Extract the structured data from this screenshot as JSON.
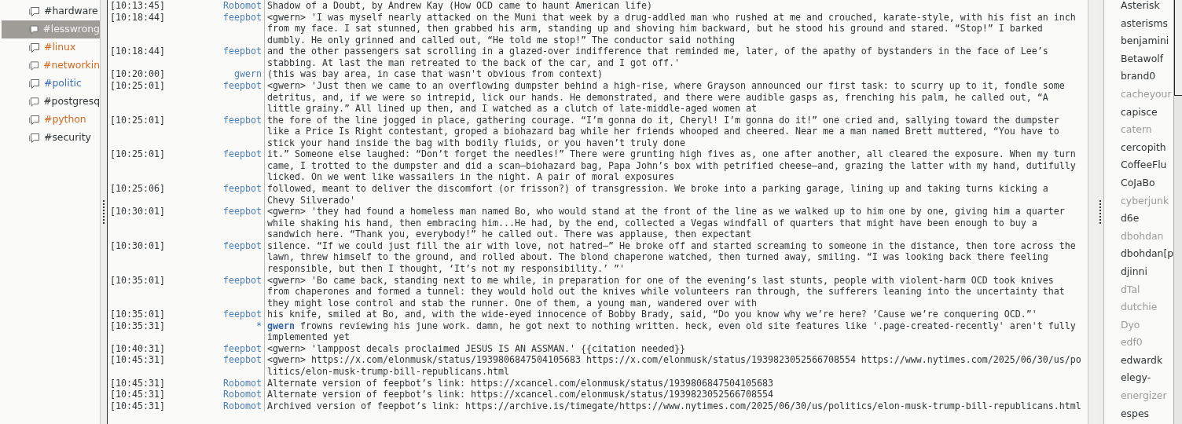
{
  "channels": [
    {
      "name": "#hardware",
      "selected": false,
      "color": "#2e3436"
    },
    {
      "name": "#lesswrong",
      "selected": true,
      "color": "#f4f4f2"
    },
    {
      "name": "#linux",
      "selected": false,
      "color": "#d2691e"
    },
    {
      "name": "#networkin",
      "selected": false,
      "color": "#d2691e"
    },
    {
      "name": "#politic",
      "selected": false,
      "color": "#3d6fb6"
    },
    {
      "name": "#postgresq",
      "selected": false,
      "color": "#2e3436"
    },
    {
      "name": "#python",
      "selected": false,
      "color": "#d2691e"
    },
    {
      "name": "#security",
      "selected": false,
      "color": "#2e3436"
    }
  ],
  "messages": [
    {
      "time": "[10:13:45]",
      "nick": "Robomot",
      "kind": "message",
      "lines": [
        "Shadow of a Doubt, by Andrew Kay (How OCD came to haunt American life)"
      ]
    },
    {
      "time": "[10:18:44]",
      "nick": "feepbot",
      "kind": "message",
      "lines": [
        "<gwern> 'I was myself nearly attacked on the Muni that week by a drug-addled man who rushed at me and crouched, karate-style, with his fist an inch",
        "from my face. I sat stunned, then grabbed his arm, standing up and shoving him backward, but he stood his ground and stared. “Stop!” I barked",
        "dumbly. He only grinned and called out, “He told me stop!” The conductor said nothing"
      ]
    },
    {
      "time": "[10:18:44]",
      "nick": "feepbot",
      "kind": "message",
      "lines": [
        "and the other passengers sat scrolling in a glazed-over indifference that reminded me, later, of the apathy of bystanders in the face of Lee’s",
        "stabbing. At last the man retreated to the back of the car, and I got off.'"
      ]
    },
    {
      "time": "[10:20:00]",
      "nick": "gwern",
      "kind": "message",
      "lines": [
        "(this was bay area, in case that wasn't obvious from context)"
      ]
    },
    {
      "time": "[10:25:01]",
      "nick": "feepbot",
      "kind": "message",
      "lines": [
        "<gwern> 'Just then we came to an overflowing dumpster behind a high-rise, where Grayson announced our first task: to scurry up to it, fondle some",
        "detritus, and, if we were so intrepid, lick our hands. He demonstrated, and there were audible gasps as, frenching his palm, he called out, “A",
        "little grainy.” All lined up then, and I watched as a clutch of late-middle-aged women at"
      ]
    },
    {
      "time": "[10:25:01]",
      "nick": "feepbot",
      "kind": "message",
      "lines": [
        "the fore of the line jogged in place, gathering courage. “I’m gonna do it, Cheryl! I’m gonna do it!” one cried and, sallying toward the dumpster",
        "like a Price Is Right contestant, groped a biohazard bag while her friends whooped and cheered. Near me a man named Brett muttered, “You have to",
        "stick your hand inside the bag with bodily fluids, or you haven’t truly done"
      ]
    },
    {
      "time": "[10:25:01]",
      "nick": "feepbot",
      "kind": "message",
      "lines": [
        "it.” Someone else laughed: “Don’t forget the needles!” There were grunting high fives as, one after another, all cleared the exposure. When my turn",
        "came, I trotted to the dumpster and did a scan—biohazard bag, Papa John’s box with petrified cheese—and, grazing the latter with my hand, dutifully",
        "licked. On we went like wassailers in the night. A pair of moral exposures"
      ]
    },
    {
      "time": "[10:25:06]",
      "nick": "feepbot",
      "kind": "message",
      "lines": [
        "followed, meant to deliver the discomfort (or frisson?) of transgression. We broke into a parking garage, lining up and taking turns kicking a",
        "Chevy Silverado'"
      ]
    },
    {
      "time": "[10:30:01]",
      "nick": "feepbot",
      "kind": "message",
      "lines": [
        "<gwern> 'they had found a homeless man named Bo, who would stand at the front of the line as we walked up to him one by one, giving him a quarter",
        "while shaking his hand, then embracing him...He had, by the end, collected a Vegas windfall of quarters that might have been enough to buy a",
        "sandwich here. “Thank you, everybody!” he called out. There was applause, then expectant"
      ]
    },
    {
      "time": "[10:30:01]",
      "nick": "feepbot",
      "kind": "message",
      "lines": [
        "silence. “If we could just fill the air with love, not hatred—” He broke off and started screaming to someone in the distance, then tore across the",
        "lawn, threw himself to the ground, and rolled about. The blond chaperone watched, then turned away, smiling. “I was looking back there feeling",
        "responsible, but then I thought, ‘It’s not my responsibility.’ ”'"
      ]
    },
    {
      "time": "[10:35:01]",
      "nick": "feepbot",
      "kind": "message",
      "lines": [
        "<gwern> 'Bo came back, standing next to me while, in preparation for one of the evening’s last stunts, people with violent-harm OCD took knives",
        "from chaperones and formed a tunnel: they would hold out the knives while volunteers ran through, the sufferers leaning into the uncertainty that",
        "they might lose control and stab the runner. One of them, a young man, wandered over with"
      ]
    },
    {
      "time": "[10:35:01]",
      "nick": "feepbot",
      "kind": "message",
      "lines": [
        "his knife, smiled at Bo, and, with the wide-eyed innocence of Bobby Brady, said, “Do you know why we’re here? ’Cause we’re conquering OCD.”'"
      ]
    },
    {
      "time": "[10:35:31]",
      "nick": "*",
      "kind": "action",
      "lines": [
        "**gwern** frowns reviewing his june work. damn, he got next to nothing written. heck, even old site features like '.page-created-recently' aren't fully",
        "implemented yet"
      ]
    },
    {
      "time": "[10:40:31]",
      "nick": "feepbot",
      "kind": "message",
      "lines": [
        "<gwern> 'lamppost decals proclaimed JESUS IS AN ASSMAN.' {{citation needed}}"
      ]
    },
    {
      "time": "[10:45:31]",
      "nick": "feepbot",
      "kind": "message",
      "lines": [
        "<gwern> https://x.com/elonmusk/status/1939806847504105683 https://x.com/elonmusk/status/1939823052566708554 https://www.nytimes.com/2025/06/30/us/po",
        "litics/elon-musk-trump-bill-republicans.html"
      ]
    },
    {
      "time": "[10:45:31]",
      "nick": "Robomot",
      "kind": "message",
      "lines": [
        "Alternate version of feepbot’s link: https://xcancel.com/elonmusk/status/1939806847504105683"
      ]
    },
    {
      "time": "[10:45:31]",
      "nick": "Robomot",
      "kind": "message",
      "lines": [
        "Alternate version of feepbot’s link: https://xcancel.com/elonmusk/status/1939823052566708554"
      ]
    },
    {
      "time": "[10:45:31]",
      "nick": "Robomot",
      "kind": "message",
      "lines": [
        "Archived version of feepbot’s link: https://archive.is/timegate/https://www.nytimes.com/2025/06/30/us/politics/elon-musk-trump-bill-republicans.html"
      ]
    }
  ],
  "nicks": [
    {
      "name": "Asterisk",
      "away": false
    },
    {
      "name": "asterisms",
      "away": false
    },
    {
      "name": "benjamini",
      "away": false
    },
    {
      "name": "Betawolf",
      "away": false
    },
    {
      "name": "brand0",
      "away": false
    },
    {
      "name": "cacheyour",
      "away": true
    },
    {
      "name": "capisce",
      "away": false
    },
    {
      "name": "catern",
      "away": true
    },
    {
      "name": "cercopith",
      "away": false
    },
    {
      "name": "CoffeeFlu",
      "away": false
    },
    {
      "name": "CoJaBo",
      "away": false
    },
    {
      "name": "cyberjunk",
      "away": true
    },
    {
      "name": "d6e",
      "away": false
    },
    {
      "name": "dbohdan",
      "away": true
    },
    {
      "name": "dbohdan[p",
      "away": false
    },
    {
      "name": "djinni",
      "away": false
    },
    {
      "name": "dTal",
      "away": true
    },
    {
      "name": "dutchie",
      "away": true
    },
    {
      "name": "Dyo",
      "away": true
    },
    {
      "name": "edf0",
      "away": true
    },
    {
      "name": "edwardk",
      "away": false
    },
    {
      "name": "elegy-",
      "away": false
    },
    {
      "name": "energizer",
      "away": true
    },
    {
      "name": "espes",
      "away": false
    }
  ]
}
